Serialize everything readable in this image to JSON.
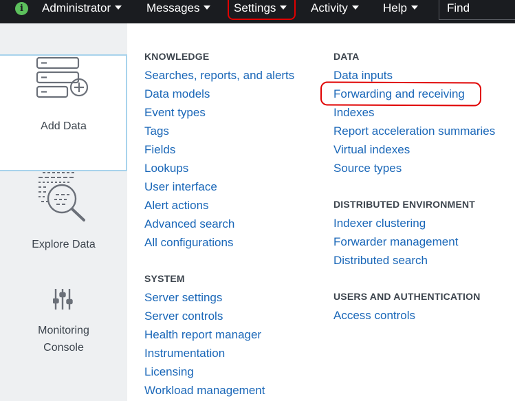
{
  "topbar": {
    "info_icon": "i",
    "items": [
      {
        "label": "Administrator"
      },
      {
        "label": "Messages"
      },
      {
        "label": "Settings"
      },
      {
        "label": "Activity"
      },
      {
        "label": "Help"
      }
    ],
    "find_label": "Find",
    "highlight_color": "#e00000"
  },
  "left_panel": {
    "items": [
      {
        "label": "Add Data",
        "icon": "add-data-icon"
      },
      {
        "label": "Explore Data",
        "icon": "explore-data-icon"
      },
      {
        "label_line1": "Monitoring",
        "label_line2": "Console",
        "icon": "monitoring-console-icon"
      }
    ]
  },
  "menu": {
    "knowledge": {
      "title": "KNOWLEDGE",
      "links": [
        "Searches, reports, and alerts",
        "Data models",
        "Event types",
        "Tags",
        "Fields",
        "Lookups",
        "User interface",
        "Alert actions",
        "Advanced search",
        "All configurations"
      ]
    },
    "system": {
      "title": "SYSTEM",
      "links": [
        "Server settings",
        "Server controls",
        "Health report manager",
        "Instrumentation",
        "Licensing",
        "Workload management"
      ]
    },
    "data": {
      "title": "DATA",
      "links": [
        "Data inputs",
        "Forwarding and receiving",
        "Indexes",
        "Report acceleration summaries",
        "Virtual indexes",
        "Source types"
      ]
    },
    "distributed": {
      "title": "DISTRIBUTED ENVIRONMENT",
      "links": [
        "Indexer clustering",
        "Forwarder management",
        "Distributed search"
      ]
    },
    "users": {
      "title": "USERS AND AUTHENTICATION",
      "links": [
        "Access controls"
      ]
    }
  },
  "colors": {
    "link": "#1a67b8",
    "topbar_bg": "#1a1c20",
    "panel_bg": "#eef0f2",
    "info_green": "#5cc05c"
  }
}
